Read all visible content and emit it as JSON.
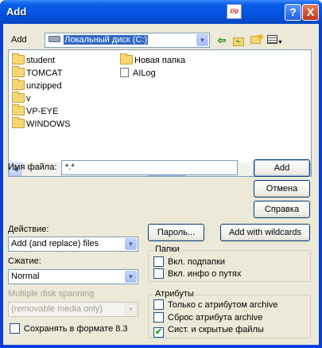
{
  "window": {
    "title": "Add",
    "zip_icon": "zip"
  },
  "titlebar_buttons": {
    "help": "?",
    "close": "X"
  },
  "add_in": {
    "label": "Add",
    "drive": "Локальный диск (C:)"
  },
  "toolbar": {
    "icons": [
      "back-arrow-icon",
      "up-folder-icon",
      "new-folder-icon",
      "view-menu-icon"
    ]
  },
  "files": {
    "column1": [
      "student",
      "TOMCAT",
      "unzipped",
      "v",
      "VP-EYE",
      "WINDOWS"
    ],
    "column2_folders": [
      "Новая папка"
    ],
    "column2_files": [
      "AILog"
    ]
  },
  "filename": {
    "label": "Имя файла:",
    "value": "*.*"
  },
  "buttons": {
    "add": "Add",
    "cancel": "Отмена",
    "help": "Справка",
    "password": "Пароль...",
    "wildcards": "Add with wildcards"
  },
  "action": {
    "label": "Действие:",
    "value": "Add (and replace) files"
  },
  "compression": {
    "label": "Сжатие:",
    "value": "Normal"
  },
  "spanning": {
    "label": "Multiple disk spanning",
    "value": "(removable media only)"
  },
  "save83": {
    "label": "Сохранять в формате 8.3",
    "checked": false
  },
  "folders_group": {
    "title": "Папки",
    "subfolders": {
      "label": "Вкл. подпапки",
      "checked": false
    },
    "path_info": {
      "label": "Вкл. инфо о путях",
      "checked": false
    }
  },
  "attributes_group": {
    "title": "Атрибуты",
    "archive_only": {
      "label": "Только с атрибутом archive",
      "checked": false
    },
    "reset_archive": {
      "label": "Сброс атрибута archive",
      "checked": false
    },
    "system_hidden": {
      "label": "Сист. и скрытые файлы",
      "checked": true,
      "mark": "✔"
    }
  }
}
